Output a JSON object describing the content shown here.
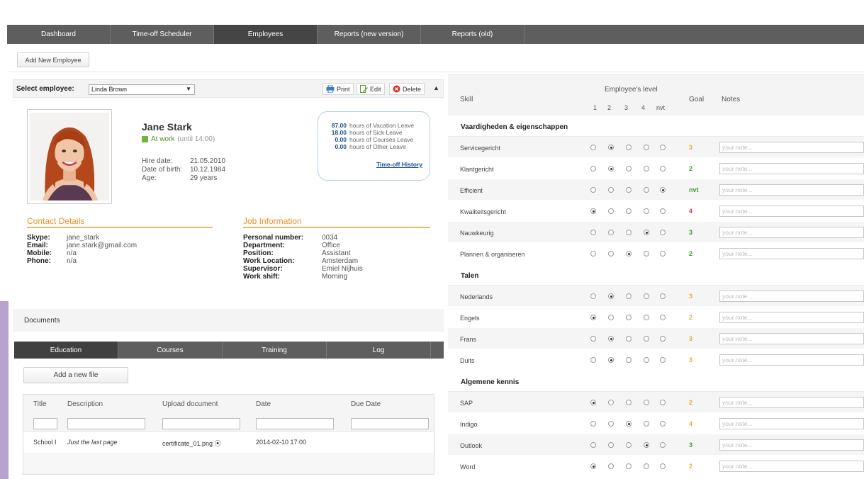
{
  "nav": {
    "tabs": [
      "Dashboard",
      "Time-off Scheduler",
      "Employees",
      "Reports (new version)",
      "Reports (old)"
    ],
    "active": "Employees"
  },
  "toolbar": {
    "add_employee_label": "Add New Employee"
  },
  "employee_selector": {
    "label": "Select employee:",
    "selected": "Linda Brown"
  },
  "actions": {
    "print": "Print",
    "edit": "Edit",
    "delete": "Delete"
  },
  "profile": {
    "name": "Jane Stark",
    "status": "At work",
    "status_until": "(until 14:00)",
    "hire_date_label": "Hire date:",
    "hire_date": "21.05.2010",
    "dob_label": "Date of birth:",
    "dob": "10.12.1984",
    "age_label": "Age:",
    "age": "29 years"
  },
  "leave": {
    "items": [
      {
        "value": "87.00",
        "text": "hours of Vacation Leave"
      },
      {
        "value": "18.00",
        "text": "hours of Sick Leave"
      },
      {
        "value": "0.00",
        "text": "hours of Courses Leave"
      },
      {
        "value": "0.00",
        "text": "hours of Other Leave"
      }
    ],
    "history_link": "Time-off History"
  },
  "contact": {
    "title": "Contact Details",
    "rows": [
      {
        "k": "Skype:",
        "v": "jane_stark"
      },
      {
        "k": "Email:",
        "v": "jane.stark@gmail.com"
      },
      {
        "k": "Mobile:",
        "v": "n/a"
      },
      {
        "k": "Phone:",
        "v": "n/a"
      }
    ]
  },
  "job": {
    "title": "Job Information",
    "rows": [
      {
        "k": "Personal number:",
        "v": "0034"
      },
      {
        "k": "Department:",
        "v": "Office"
      },
      {
        "k": "Position:",
        "v": "Assistant"
      },
      {
        "k": "Work Location:",
        "v": "Amsterdam"
      },
      {
        "k": "Supervisor:",
        "v": "Emiel Nijhuis"
      },
      {
        "k": "Work shift:",
        "v": "Morning"
      }
    ]
  },
  "documents": {
    "label": "Documents"
  },
  "subtabs": {
    "items": [
      "Education",
      "Courses",
      "Training",
      "Log"
    ],
    "active": "Education"
  },
  "files": {
    "add_label": "Add a new file",
    "columns": [
      "Title",
      "Description",
      "Upload document",
      "Date",
      "Due Date"
    ],
    "rows": [
      {
        "title": "School I",
        "description": "Just the last page",
        "upload": "certificate_01.png",
        "date": "2014-02-10 17:00",
        "due": ""
      }
    ]
  },
  "skills": {
    "headers": {
      "skill": "Skill",
      "level": "Employee's level",
      "goal": "Goal",
      "notes": "Notes"
    },
    "levels": [
      "1",
      "2",
      "3",
      "4",
      "nvt"
    ],
    "note_placeholder": "your note...",
    "goal_colors": {
      "3": "#e8a030",
      "2": "#4a9a2a",
      "nvt": "#4a9a2a",
      "4": "#d93a2a"
    },
    "categories": [
      {
        "name": "Vaardigheden & eigenschappen",
        "skills": [
          {
            "name": "Servicegericht",
            "level": 2,
            "goal": "3",
            "goal_color": "#f0a830"
          },
          {
            "name": "Klantgericht",
            "level": 2,
            "goal": "2",
            "goal_color": "#3a9a2a"
          },
          {
            "name": "Efficient",
            "level": 5,
            "goal": "nvt",
            "goal_color": "#3a9a2a"
          },
          {
            "name": "Kwaliteitsgericht",
            "level": 1,
            "goal": "4",
            "goal_color": "#e03a2a"
          },
          {
            "name": "Nauwkeurig",
            "level": 4,
            "goal": "3",
            "goal_color": "#3a9a2a"
          },
          {
            "name": "Plannen & organiseren",
            "level": 3,
            "goal": "2",
            "goal_color": "#3a9a2a"
          }
        ]
      },
      {
        "name": "Talen",
        "skills": [
          {
            "name": "Nederlands",
            "level": 2,
            "goal": "3",
            "goal_color": "#f0a830"
          },
          {
            "name": "Engels",
            "level": 1,
            "goal": "2",
            "goal_color": "#f0a830"
          },
          {
            "name": "Frans",
            "level": 2,
            "goal": "3",
            "goal_color": "#f0a830"
          },
          {
            "name": "Duits",
            "level": 2,
            "goal": "3",
            "goal_color": "#f0a830"
          }
        ]
      },
      {
        "name": "Algemene kennis",
        "skills": [
          {
            "name": "SAP",
            "level": 1,
            "goal": "2",
            "goal_color": "#f0a830"
          },
          {
            "name": "Indigo",
            "level": 3,
            "goal": "4",
            "goal_color": "#f0a830"
          },
          {
            "name": "Outlook",
            "level": 4,
            "goal": "3",
            "goal_color": "#3a9a2a"
          },
          {
            "name": "Word",
            "level": 1,
            "goal": "2",
            "goal_color": "#f0a830"
          }
        ]
      }
    ]
  }
}
